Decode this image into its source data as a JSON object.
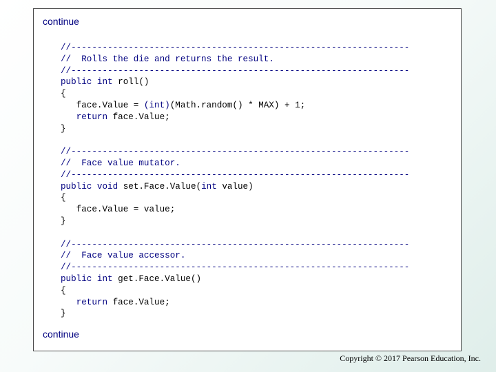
{
  "header": {
    "continue_label": "continue"
  },
  "footer": {
    "continue_label": "continue",
    "copyright": "Copyright © 2017 Pearson Education, Inc."
  },
  "colors": {
    "comment": "#000080",
    "keyword": "#000080",
    "text": "#000000",
    "background_gradient_end": "#dfeeea"
  },
  "code_lines": [
    [
      {
        "t": "comment",
        "s": "//-----------------------------------------------------------------"
      }
    ],
    [
      {
        "t": "comment",
        "s": "//  Rolls the die and returns the result."
      }
    ],
    [
      {
        "t": "comment",
        "s": "//-----------------------------------------------------------------"
      }
    ],
    [
      {
        "t": "kw",
        "s": "public int "
      },
      {
        "t": "plain",
        "s": "roll()"
      }
    ],
    [
      {
        "t": "plain",
        "s": "{"
      }
    ],
    [
      {
        "t": "plain",
        "s": "   face.Value = "
      },
      {
        "t": "kw",
        "s": "(int)"
      },
      {
        "t": "plain",
        "s": "(Math.random() * MAX) + 1;"
      }
    ],
    [
      {
        "t": "plain",
        "s": "   "
      },
      {
        "t": "kw",
        "s": "return "
      },
      {
        "t": "plain",
        "s": "face.Value;"
      }
    ],
    [
      {
        "t": "plain",
        "s": "}"
      }
    ],
    [
      {
        "t": "plain",
        "s": ""
      }
    ],
    [
      {
        "t": "comment",
        "s": "//-----------------------------------------------------------------"
      }
    ],
    [
      {
        "t": "comment",
        "s": "//  Face value mutator."
      }
    ],
    [
      {
        "t": "comment",
        "s": "//-----------------------------------------------------------------"
      }
    ],
    [
      {
        "t": "kw",
        "s": "public void "
      },
      {
        "t": "plain",
        "s": "set.Face.Value("
      },
      {
        "t": "kw",
        "s": "int "
      },
      {
        "t": "plain",
        "s": "value)"
      }
    ],
    [
      {
        "t": "plain",
        "s": "{"
      }
    ],
    [
      {
        "t": "plain",
        "s": "   face.Value = value;"
      }
    ],
    [
      {
        "t": "plain",
        "s": "}"
      }
    ],
    [
      {
        "t": "plain",
        "s": ""
      }
    ],
    [
      {
        "t": "comment",
        "s": "//-----------------------------------------------------------------"
      }
    ],
    [
      {
        "t": "comment",
        "s": "//  Face value accessor."
      }
    ],
    [
      {
        "t": "comment",
        "s": "//-----------------------------------------------------------------"
      }
    ],
    [
      {
        "t": "kw",
        "s": "public int "
      },
      {
        "t": "plain",
        "s": "get.Face.Value()"
      }
    ],
    [
      {
        "t": "plain",
        "s": "{"
      }
    ],
    [
      {
        "t": "plain",
        "s": "   "
      },
      {
        "t": "kw",
        "s": "return "
      },
      {
        "t": "plain",
        "s": "face.Value;"
      }
    ],
    [
      {
        "t": "plain",
        "s": "}"
      }
    ]
  ]
}
